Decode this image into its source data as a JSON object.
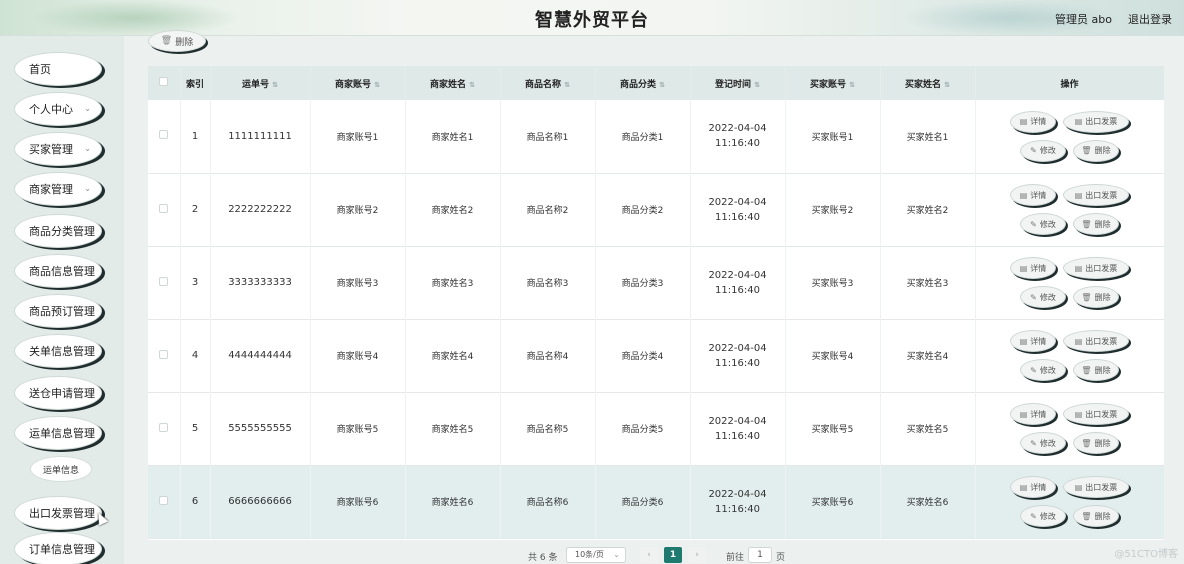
{
  "header": {
    "title": "智慧外贸平台",
    "user": "管理员 abo",
    "logout": "退出登录"
  },
  "sidebar": {
    "items": [
      {
        "label": "首页",
        "arrow": false
      },
      {
        "label": "个人中心",
        "arrow": true
      },
      {
        "label": "买家管理",
        "arrow": true
      },
      {
        "label": "商家管理",
        "arrow": true
      },
      {
        "label": "商品分类管理",
        "arrow": false
      },
      {
        "label": "商品信息管理",
        "arrow": false
      },
      {
        "label": "商品预订管理",
        "arrow": false
      },
      {
        "label": "关单信息管理",
        "arrow": false
      },
      {
        "label": "送仓申请管理",
        "arrow": false
      },
      {
        "label": "运单信息管理",
        "arrow": false
      },
      {
        "label": "出口发票管理",
        "arrow": false
      },
      {
        "label": "订单信息管理",
        "arrow": false
      }
    ],
    "submenu": "运单信息"
  },
  "toolbar": {
    "delete_label": "删除"
  },
  "table": {
    "headers": [
      "索引",
      "运单号",
      "商家账号",
      "商家姓名",
      "商品名称",
      "商品分类",
      "登记时间",
      "买家账号",
      "买家姓名",
      "操作"
    ],
    "rows": [
      {
        "index": "1",
        "waybill": "1111111111",
        "merchant_acct": "商家账号1",
        "merchant_name": "商家姓名1",
        "product": "商品名称1",
        "category": "商品分类1",
        "time": "2022-04-04 11:16:40",
        "buyer_acct": "买家账号1",
        "buyer_name": "买家姓名1"
      },
      {
        "index": "2",
        "waybill": "2222222222",
        "merchant_acct": "商家账号2",
        "merchant_name": "商家姓名2",
        "product": "商品名称2",
        "category": "商品分类2",
        "time": "2022-04-04 11:16:40",
        "buyer_acct": "买家账号2",
        "buyer_name": "买家姓名2"
      },
      {
        "index": "3",
        "waybill": "3333333333",
        "merchant_acct": "商家账号3",
        "merchant_name": "商家姓名3",
        "product": "商品名称3",
        "category": "商品分类3",
        "time": "2022-04-04 11:16:40",
        "buyer_acct": "买家账号3",
        "buyer_name": "买家姓名3"
      },
      {
        "index": "4",
        "waybill": "4444444444",
        "merchant_acct": "商家账号4",
        "merchant_name": "商家姓名4",
        "product": "商品名称4",
        "category": "商品分类4",
        "time": "2022-04-04 11:16:40",
        "buyer_acct": "买家账号4",
        "buyer_name": "买家姓名4"
      },
      {
        "index": "5",
        "waybill": "5555555555",
        "merchant_acct": "商家账号5",
        "merchant_name": "商家姓名5",
        "product": "商品名称5",
        "category": "商品分类5",
        "time": "2022-04-04 11:16:40",
        "buyer_acct": "买家账号5",
        "buyer_name": "买家姓名5"
      },
      {
        "index": "6",
        "waybill": "6666666666",
        "merchant_acct": "商家账号6",
        "merchant_name": "商家姓名6",
        "product": "商品名称6",
        "category": "商品分类6",
        "time": "2022-04-04 11:16:40",
        "buyer_acct": "买家账号6",
        "buyer_name": "买家姓名6"
      }
    ],
    "actions": {
      "detail": "详情",
      "invoice": "出口发票",
      "edit": "修改",
      "delete": "删除"
    }
  },
  "pagination": {
    "total": "共 6 条",
    "page_size": "10条/页",
    "current_page": "1",
    "goto_label": "前往",
    "goto_value": "1",
    "page_suffix": "页"
  },
  "watermark": "@51CTO博客",
  "colors": {
    "accent": "#1e7a6e",
    "header_bg": "#dfe9e8",
    "highlight_row": "#e2eeee"
  }
}
